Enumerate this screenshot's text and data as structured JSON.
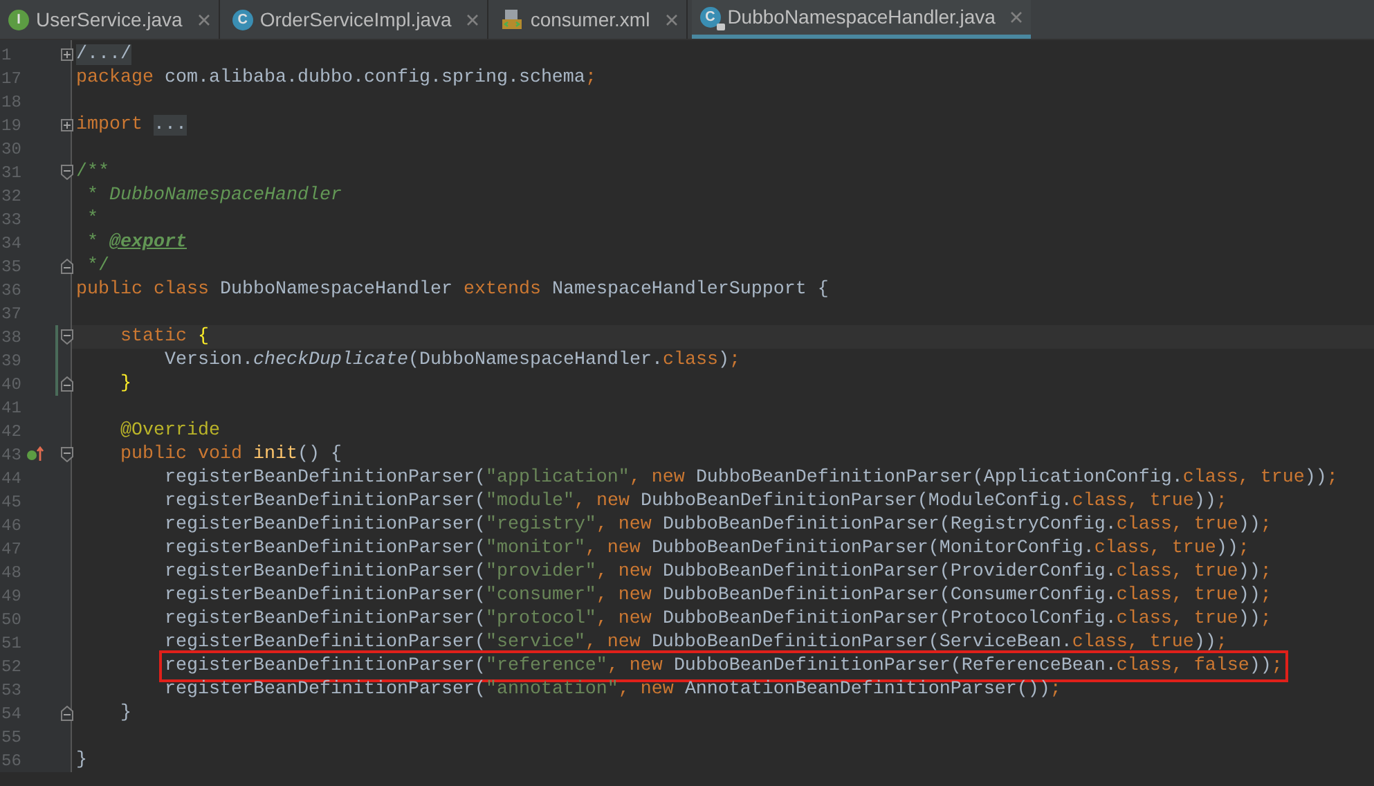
{
  "tabs": [
    {
      "label": "UserService.java",
      "kind": "interface",
      "icon": "I",
      "selected": false
    },
    {
      "label": "OrderServiceImpl.java",
      "kind": "class",
      "icon": "C",
      "selected": false
    },
    {
      "label": "consumer.xml",
      "kind": "xml",
      "selected": false
    },
    {
      "label": "DubboNamespaceHandler.java",
      "kind": "class",
      "icon": "C",
      "selected": true
    }
  ],
  "lines": [
    {
      "number": "1",
      "collapsed": true,
      "tokens": [
        {
          "kind": "folded",
          "text": "/.../"
        }
      ]
    },
    {
      "number": "17",
      "tokens": [
        {
          "kind": "keyword",
          "text": "package "
        },
        {
          "kind": "plain",
          "text": "com.alibaba.dubbo.config.spring.schema"
        },
        {
          "kind": "keyword",
          "text": ";"
        }
      ]
    },
    {
      "number": "18"
    },
    {
      "number": "19",
      "collapsed": true,
      "tokens": [
        {
          "kind": "keyword",
          "text": "import "
        },
        {
          "kind": "folded",
          "text": "..."
        }
      ]
    },
    {
      "number": "30"
    },
    {
      "number": "31",
      "fold_start": true,
      "tokens": [
        {
          "kind": "doc",
          "text": "/**"
        }
      ]
    },
    {
      "number": "32",
      "tokens": [
        {
          "kind": "doc",
          "text": " * "
        },
        {
          "kind": "doc-italic",
          "text": "DubboNamespaceHandler"
        }
      ]
    },
    {
      "number": "33",
      "tokens": [
        {
          "kind": "doc",
          "text": " *"
        }
      ]
    },
    {
      "number": "34",
      "tokens": [
        {
          "kind": "doc",
          "text": " * "
        },
        {
          "kind": "doc-tag",
          "text": "@export"
        }
      ]
    },
    {
      "number": "35",
      "fold_end": true,
      "tokens": [
        {
          "kind": "doc",
          "text": " */"
        }
      ]
    },
    {
      "number": "36",
      "tokens": [
        {
          "kind": "keyword",
          "text": "public class "
        },
        {
          "kind": "plain",
          "text": "DubboNamespaceHandler "
        },
        {
          "kind": "keyword",
          "text": "extends "
        },
        {
          "kind": "plain",
          "text": "NamespaceHandlerSupport {"
        }
      ]
    },
    {
      "number": "37"
    },
    {
      "number": "38",
      "fold_start": true,
      "current": true,
      "changed": true,
      "tokens": [
        {
          "kind": "keyword",
          "text": "    static "
        },
        {
          "kind": "brace",
          "text": "{"
        }
      ]
    },
    {
      "number": "39",
      "changed": true,
      "tokens": [
        {
          "kind": "plain",
          "text": "        Version."
        },
        {
          "kind": "italic",
          "text": "checkDuplicate"
        },
        {
          "kind": "plain",
          "text": "(DubboNamespaceHandler."
        },
        {
          "kind": "keyword",
          "text": "class"
        },
        {
          "kind": "plain",
          "text": ")"
        },
        {
          "kind": "keyword",
          "text": ";"
        }
      ]
    },
    {
      "number": "40",
      "fold_end": true,
      "changed": true,
      "tokens": [
        {
          "kind": "brace",
          "text": "    }"
        }
      ]
    },
    {
      "number": "41"
    },
    {
      "number": "42",
      "tokens": [
        {
          "kind": "annotation",
          "text": "    @Override"
        }
      ]
    },
    {
      "number": "43",
      "fold_start": true,
      "overrides": true,
      "tokens": [
        {
          "kind": "keyword",
          "text": "    public void "
        },
        {
          "kind": "method",
          "text": "init"
        },
        {
          "kind": "plain",
          "text": "() {"
        }
      ]
    },
    {
      "number": "44",
      "tokens": [
        {
          "kind": "plain",
          "text": "        registerBeanDefinitionParser("
        },
        {
          "kind": "string",
          "text": "\"application\""
        },
        {
          "kind": "keyword",
          "text": ", new "
        },
        {
          "kind": "plain",
          "text": "DubboBeanDefinitionParser(ApplicationConfig."
        },
        {
          "kind": "keyword",
          "text": "class, true"
        },
        {
          "kind": "plain",
          "text": "))"
        },
        {
          "kind": "keyword",
          "text": ";"
        }
      ]
    },
    {
      "number": "45",
      "tokens": [
        {
          "kind": "plain",
          "text": "        registerBeanDefinitionParser("
        },
        {
          "kind": "string",
          "text": "\"module\""
        },
        {
          "kind": "keyword",
          "text": ", new "
        },
        {
          "kind": "plain",
          "text": "DubboBeanDefinitionParser(ModuleConfig."
        },
        {
          "kind": "keyword",
          "text": "class, true"
        },
        {
          "kind": "plain",
          "text": "))"
        },
        {
          "kind": "keyword",
          "text": ";"
        }
      ]
    },
    {
      "number": "46",
      "tokens": [
        {
          "kind": "plain",
          "text": "        registerBeanDefinitionParser("
        },
        {
          "kind": "string",
          "text": "\"registry\""
        },
        {
          "kind": "keyword",
          "text": ", new "
        },
        {
          "kind": "plain",
          "text": "DubboBeanDefinitionParser(RegistryConfig."
        },
        {
          "kind": "keyword",
          "text": "class, true"
        },
        {
          "kind": "plain",
          "text": "))"
        },
        {
          "kind": "keyword",
          "text": ";"
        }
      ]
    },
    {
      "number": "47",
      "tokens": [
        {
          "kind": "plain",
          "text": "        registerBeanDefinitionParser("
        },
        {
          "kind": "string",
          "text": "\"monitor\""
        },
        {
          "kind": "keyword",
          "text": ", new "
        },
        {
          "kind": "plain",
          "text": "DubboBeanDefinitionParser(MonitorConfig."
        },
        {
          "kind": "keyword",
          "text": "class, true"
        },
        {
          "kind": "plain",
          "text": "))"
        },
        {
          "kind": "keyword",
          "text": ";"
        }
      ]
    },
    {
      "number": "48",
      "tokens": [
        {
          "kind": "plain",
          "text": "        registerBeanDefinitionParser("
        },
        {
          "kind": "string",
          "text": "\"provider\""
        },
        {
          "kind": "keyword",
          "text": ", new "
        },
        {
          "kind": "plain",
          "text": "DubboBeanDefinitionParser(ProviderConfig."
        },
        {
          "kind": "keyword",
          "text": "class, true"
        },
        {
          "kind": "plain",
          "text": "))"
        },
        {
          "kind": "keyword",
          "text": ";"
        }
      ]
    },
    {
      "number": "49",
      "tokens": [
        {
          "kind": "plain",
          "text": "        registerBeanDefinitionParser("
        },
        {
          "kind": "string",
          "text": "\"consumer\""
        },
        {
          "kind": "keyword",
          "text": ", new "
        },
        {
          "kind": "plain",
          "text": "DubboBeanDefinitionParser(ConsumerConfig."
        },
        {
          "kind": "keyword",
          "text": "class, true"
        },
        {
          "kind": "plain",
          "text": "))"
        },
        {
          "kind": "keyword",
          "text": ";"
        }
      ]
    },
    {
      "number": "50",
      "tokens": [
        {
          "kind": "plain",
          "text": "        registerBeanDefinitionParser("
        },
        {
          "kind": "string",
          "text": "\"protocol\""
        },
        {
          "kind": "keyword",
          "text": ", new "
        },
        {
          "kind": "plain",
          "text": "DubboBeanDefinitionParser(ProtocolConfig."
        },
        {
          "kind": "keyword",
          "text": "class, true"
        },
        {
          "kind": "plain",
          "text": "))"
        },
        {
          "kind": "keyword",
          "text": ";"
        }
      ]
    },
    {
      "number": "51",
      "tokens": [
        {
          "kind": "plain",
          "text": "        registerBeanDefinitionParser("
        },
        {
          "kind": "string",
          "text": "\"service\""
        },
        {
          "kind": "keyword",
          "text": ", new "
        },
        {
          "kind": "plain",
          "text": "DubboBeanDefinitionParser(ServiceBean."
        },
        {
          "kind": "keyword",
          "text": "class, true"
        },
        {
          "kind": "plain",
          "text": "))"
        },
        {
          "kind": "keyword",
          "text": ";"
        }
      ]
    },
    {
      "number": "52",
      "boxed": true,
      "tokens": [
        {
          "kind": "plain",
          "text": "        registerBeanDefinitionParser("
        },
        {
          "kind": "string",
          "text": "\"reference\""
        },
        {
          "kind": "keyword",
          "text": ", new "
        },
        {
          "kind": "plain",
          "text": "DubboBeanDefinitionParser(ReferenceBean."
        },
        {
          "kind": "keyword",
          "text": "class, false"
        },
        {
          "kind": "plain",
          "text": "))"
        },
        {
          "kind": "keyword",
          "text": ";"
        }
      ]
    },
    {
      "number": "53",
      "tokens": [
        {
          "kind": "plain",
          "text": "        registerBeanDefinitionParser("
        },
        {
          "kind": "string",
          "text": "\"annotation\""
        },
        {
          "kind": "keyword",
          "text": ", new "
        },
        {
          "kind": "plain",
          "text": "AnnotationBeanDefinitionParser())"
        },
        {
          "kind": "keyword",
          "text": ";"
        }
      ]
    },
    {
      "number": "54",
      "fold_end": true,
      "tokens": [
        {
          "kind": "plain",
          "text": "    }"
        }
      ]
    },
    {
      "number": "55"
    },
    {
      "number": "56",
      "tokens": [
        {
          "kind": "plain",
          "text": "}"
        }
      ]
    }
  ]
}
